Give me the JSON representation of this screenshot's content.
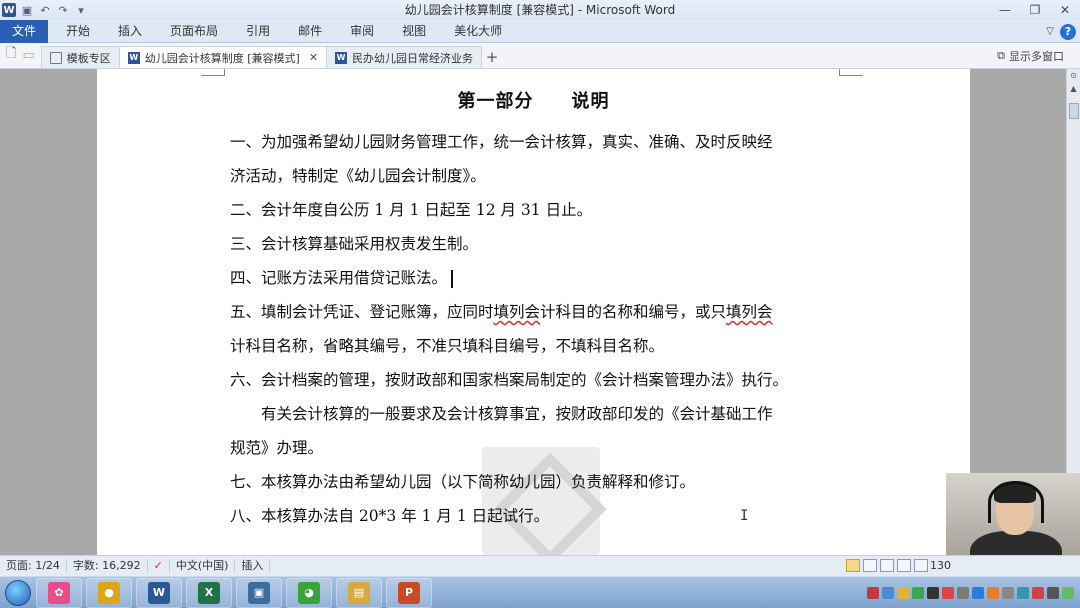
{
  "window": {
    "title": "幼儿园会计核算制度 [兼容模式] - Microsoft Word",
    "controls": {
      "minimize": "—",
      "restore": "❐",
      "close": "✕"
    }
  },
  "ribbon": {
    "tabs": [
      "文件",
      "开始",
      "插入",
      "页面布局",
      "引用",
      "邮件",
      "审阅",
      "视图",
      "美化大师"
    ]
  },
  "doc_tabs": {
    "items": [
      {
        "label": "模板专区",
        "icon": "home-icon"
      },
      {
        "label": "幼儿园会计核算制度 [兼容模式]",
        "icon": "word-doc-icon",
        "active": true
      },
      {
        "label": "民办幼儿园日常经济业务",
        "icon": "word-doc-icon"
      }
    ],
    "add": "+",
    "multi_window": "显示多窗口"
  },
  "document": {
    "title": "第一部分　　说明",
    "paragraphs": [
      "一、为加强希望幼儿园财务管理工作，统一会计核算，真实、准确、及时反映经",
      "济活动，特制定《幼儿园会计制度》。",
      "二、会计年度自公历 1 月 1 日起至 12 月 31 日止。",
      "三、会计核算基础采用权责发生制。",
      "四、记账方法采用借贷记账法。",
      "五、填制会计凭证、登记账簿，应同时填列会计科目的名称和编号，或只填列会",
      "计科目名称，省略其编号，不准只填科目编号，不填科目名称。",
      "六、会计档案的管理，按财政部和国家档案局制定的《会计档案管理办法》执行。",
      "　　有关会计核算的一般要求及会计核算事宜，按财政部印发的《会计基础工作",
      "规范》办理。",
      "七、本核算办法由希望幼儿园（以下简称幼儿园）负责解释和修订。",
      "八、本核算办法自 20*3 年 1 月 1 日起试行。"
    ]
  },
  "status": {
    "page": "页面: 1/24",
    "words": "字数: 16,292",
    "language": "中文(中国)",
    "mode": "插入",
    "zoom": "130"
  },
  "taskbar": {
    "apps": [
      {
        "name": "picasa",
        "color": "#e94b8b",
        "glyph": "✿"
      },
      {
        "name": "chrome",
        "color": "#e0a417",
        "glyph": "●"
      },
      {
        "name": "word",
        "color": "#2b5797",
        "glyph": "W"
      },
      {
        "name": "excel",
        "color": "#1f7244",
        "glyph": "X"
      },
      {
        "name": "media-player",
        "color": "#3b6e9e",
        "glyph": "▣"
      },
      {
        "name": "wechat",
        "color": "#38a33a",
        "glyph": "◕"
      },
      {
        "name": "explorer",
        "color": "#d7a93f",
        "glyph": "▤"
      },
      {
        "name": "powerpoint",
        "color": "#c94a24",
        "glyph": "P"
      }
    ],
    "tray_colors": [
      "#c23b3b",
      "#4b8ad6",
      "#e2b23a",
      "#3aa655",
      "#333333",
      "#d44",
      "#7a7a7a",
      "#2d7bd8",
      "#e67e22",
      "#888888",
      "#39a",
      "#c44",
      "#555555",
      "#6b6"
    ]
  }
}
